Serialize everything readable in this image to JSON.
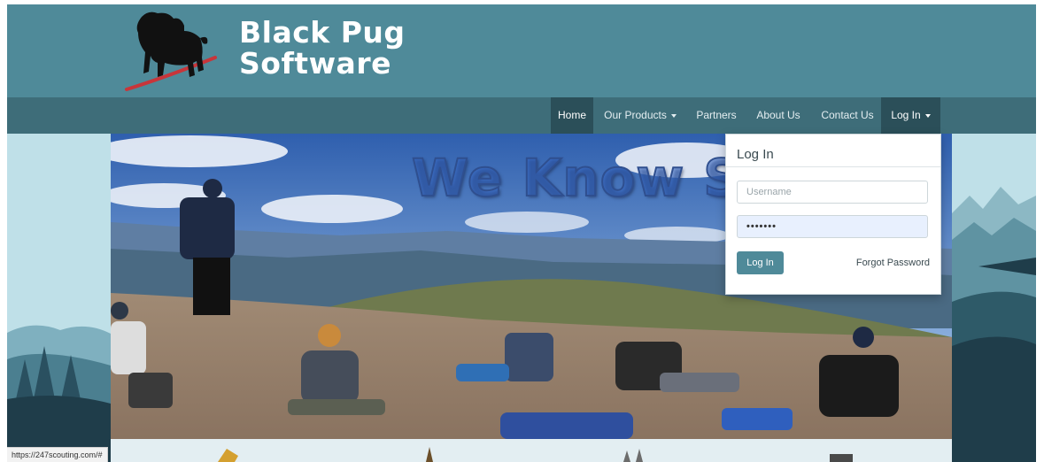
{
  "brand": {
    "line1": "Black Pug",
    "line2": "Software"
  },
  "nav": {
    "items": [
      {
        "label": "Home",
        "active": true
      },
      {
        "label": "Our Products",
        "dropdown": true
      },
      {
        "label": "Partners"
      },
      {
        "label": "About Us"
      },
      {
        "label": "Contact Us"
      },
      {
        "label": "Log In",
        "dropdown": true
      }
    ]
  },
  "hero": {
    "title": "We Know So"
  },
  "login": {
    "title": "Log In",
    "username_placeholder": "Username",
    "password_value": "•••••••",
    "button_label": "Log In",
    "forgot_label": "Forgot Password"
  },
  "status_bar": {
    "url": "https://247scouting.com/#"
  },
  "colors": {
    "banner": "#4f8a99",
    "navbar": "#3e6d79",
    "nav_active": "#2b4f59",
    "button": "#4f8a99"
  }
}
